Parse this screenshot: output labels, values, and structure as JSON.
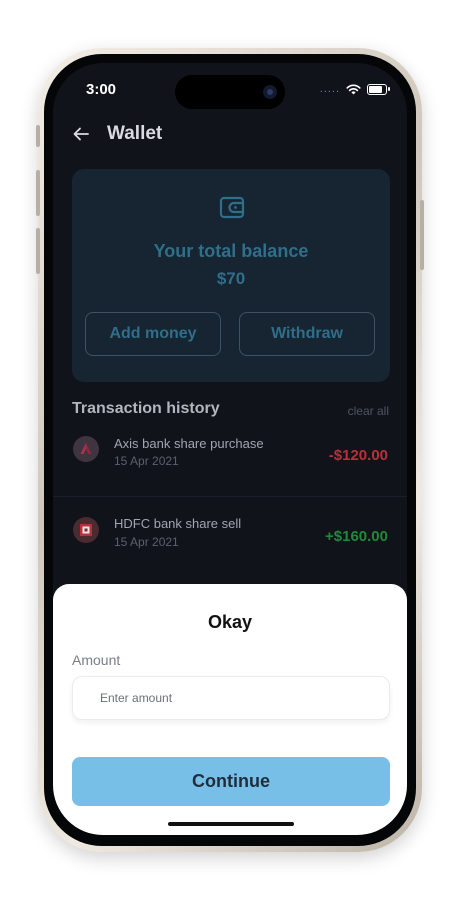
{
  "status_bar": {
    "time": "3:00",
    "signal": "....."
  },
  "header": {
    "title": "Wallet"
  },
  "balance_card": {
    "label": "Your total balance",
    "amount": "$70",
    "add_money_label": "Add money",
    "withdraw_label": "Withdraw"
  },
  "transactions": {
    "title": "Transaction history",
    "clear_all_label": "clear all",
    "items": [
      {
        "name": "Axis bank share purchase",
        "date": "15 Apr 2021",
        "amount": "-$120.00",
        "icon": "axis-bank-icon"
      },
      {
        "name": "HDFC bank share sell",
        "date": "15 Apr 2021",
        "amount": "+$160.00",
        "icon": "hdfc-bank-icon"
      }
    ]
  },
  "sheet": {
    "title": "Okay",
    "amount_label": "Amount",
    "amount_placeholder": "Enter amount",
    "continue_label": "Continue"
  },
  "colors": {
    "background": "#10131a",
    "card": "#172431",
    "accent": "#2f6f8a",
    "negative": "#b8313a",
    "positive": "#1f8a3a",
    "continue": "#77bfe6"
  }
}
